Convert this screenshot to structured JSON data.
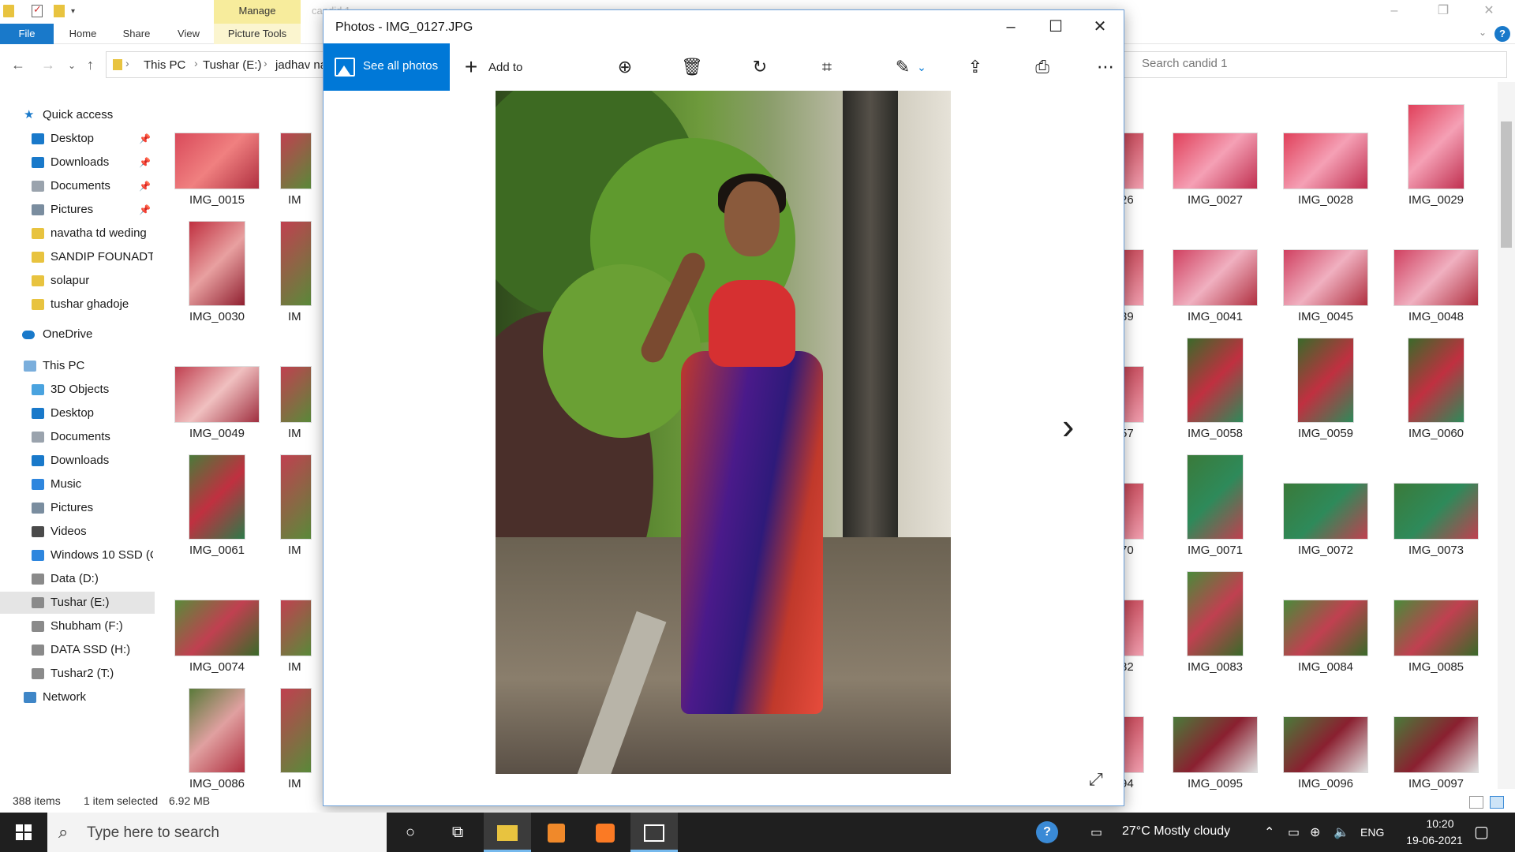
{
  "explorer": {
    "title_faded": "candid 1",
    "ribbon": {
      "manage": "Manage",
      "file": "File",
      "home": "Home",
      "share": "Share",
      "view": "View",
      "picture_tools": "Picture Tools"
    },
    "breadcrumbs": [
      "This PC",
      "Tushar (E:)",
      "jadhav na"
    ],
    "search_placeholder": "Search candid 1",
    "nav": {
      "quick_access": "Quick access",
      "quick_items": [
        "Desktop",
        "Downloads",
        "Documents",
        "Pictures",
        "navatha td weding",
        "SANDIP FOUNADTIO",
        "solapur",
        "tushar ghadoje"
      ],
      "onedrive": "OneDrive",
      "this_pc": "This PC",
      "pc_items": [
        "3D Objects",
        "Desktop",
        "Documents",
        "Downloads",
        "Music",
        "Pictures",
        "Videos",
        "Windows 10 SSD (C",
        "Data (D:)",
        "Tushar (E:)",
        "Shubham (F:)",
        "DATA SSD (H:)",
        "Tushar2 (T:)"
      ],
      "network": "Network"
    },
    "left_tiles": [
      {
        "label": "IMG_0015"
      },
      {
        "label": "IMG_0030"
      },
      {
        "label": "IMG_0049"
      },
      {
        "label": "IMG_0061"
      },
      {
        "label": "IMG_0074"
      },
      {
        "label": "IMG_0086"
      }
    ],
    "partial_col": [
      "IM",
      "IM",
      "IM",
      "IM",
      "IM",
      "IM"
    ],
    "right_partial": [
      "26",
      "39",
      "57",
      "70",
      "82",
      "94"
    ],
    "right_tiles": [
      [
        "IMG_0027",
        "IMG_0028",
        "IMG_0029"
      ],
      [
        "IMG_0041",
        "IMG_0045",
        "IMG_0048"
      ],
      [
        "IMG_0058",
        "IMG_0059",
        "IMG_0060"
      ],
      [
        "IMG_0071",
        "IMG_0072",
        "IMG_0073"
      ],
      [
        "IMG_0083",
        "IMG_0084",
        "IMG_0085"
      ],
      [
        "IMG_0095",
        "IMG_0096",
        "IMG_0097"
      ]
    ],
    "status": {
      "items": "388 items",
      "selected": "1 item selected",
      "size": "6.92 MB"
    }
  },
  "photos": {
    "title": "Photos - IMG_0127.JPG",
    "see_all": "See all photos",
    "add_to": "Add to"
  },
  "taskbar": {
    "search_placeholder": "Type here to search",
    "weather": "27°C  Mostly cloudy",
    "lang": "ENG",
    "time": "10:20",
    "date": "19-06-2021"
  },
  "colors": {
    "accent": "#0078d7",
    "file_tab": "#1979ca",
    "manage_tab": "#f7ec9c"
  }
}
